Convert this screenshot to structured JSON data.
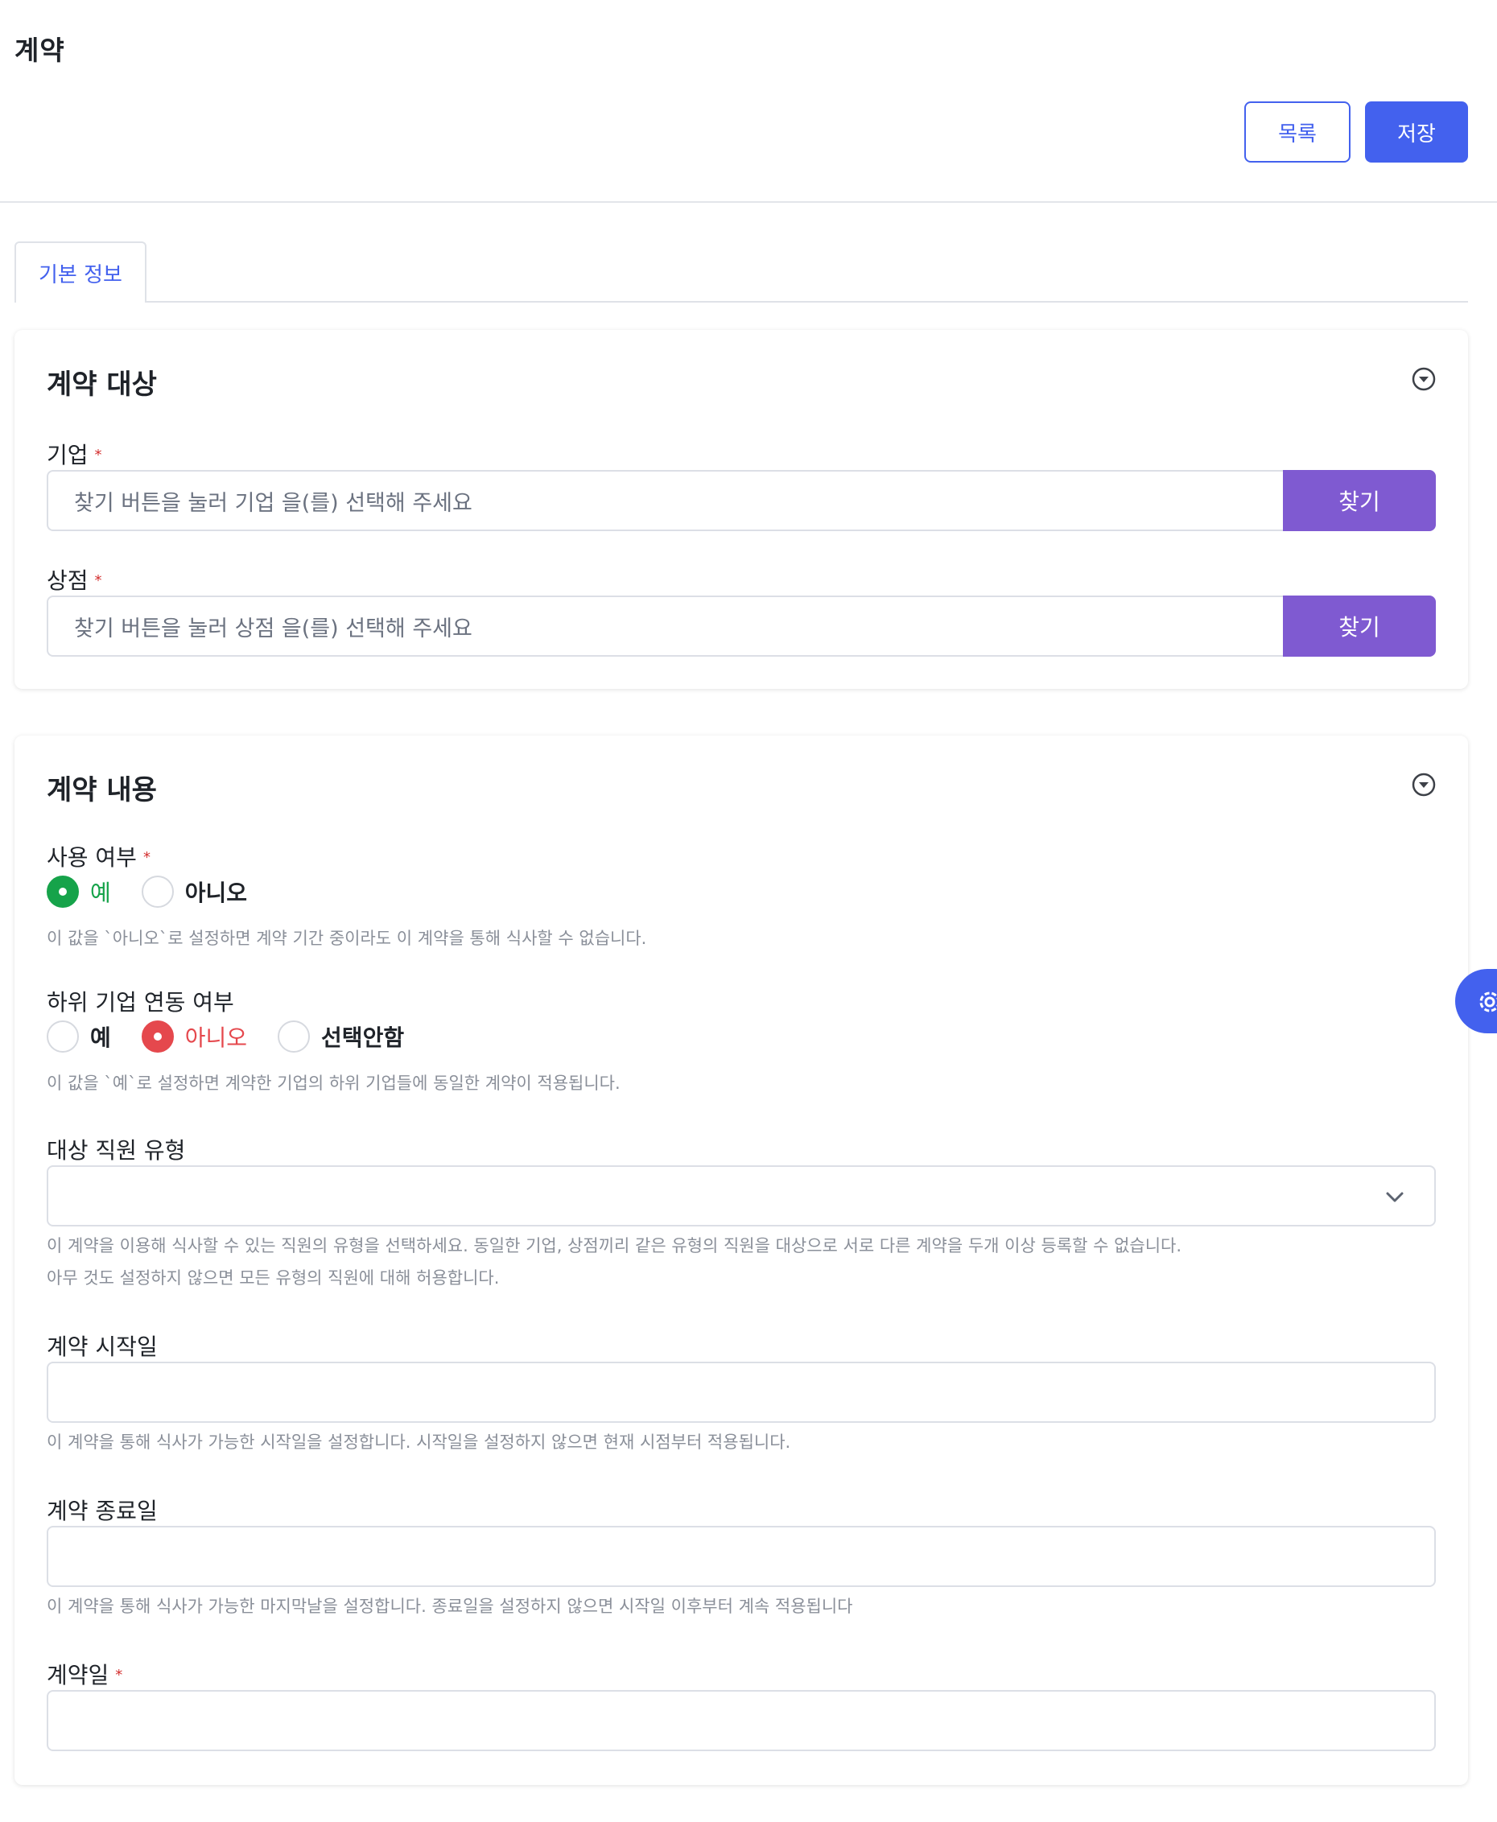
{
  "header": {
    "title": "계약",
    "list_button": "목록",
    "save_button": "저장"
  },
  "tabs": [
    {
      "label": "기본 정보",
      "active": true
    }
  ],
  "target_section": {
    "title": "계약 대상",
    "company": {
      "label": "기업",
      "required": true,
      "placeholder": "찾기 버튼을 눌러 기업 을(를) 선택해 주세요",
      "button": "찾기"
    },
    "store": {
      "label": "상점",
      "required": true,
      "placeholder": "찾기 버튼을 눌러 상점 을(를) 선택해 주세요",
      "button": "찾기"
    }
  },
  "content_section": {
    "title": "계약 내용",
    "usage": {
      "label": "사용 여부",
      "required": true,
      "options": [
        "예",
        "아니오"
      ],
      "selected": "예",
      "help": "이 값을 `아니오`로 설정하면 계약 기간 중이라도 이 계약을 통해 식사할 수 없습니다."
    },
    "sub_company_link": {
      "label": "하위 기업 연동 여부",
      "options": [
        "예",
        "아니오",
        "선택안함"
      ],
      "selected": "아니오",
      "help": "이 값을 `예`로 설정하면 계약한 기업의 하위 기업들에 동일한 계약이 적용됩니다."
    },
    "employee_type": {
      "label": "대상 직원 유형",
      "value": "",
      "help_1": "이 계약을 이용해 식사할 수 있는 직원의 유형을 선택하세요. 동일한 기업, 상점끼리 같은 유형의 직원을 대상으로 서로 다른 계약을 두개 이상 등록할 수 없습니다.",
      "help_2": "아무 것도 설정하지 않으면 모든 유형의 직원에 대해 허용합니다."
    },
    "start_date": {
      "label": "계약 시작일",
      "value": "",
      "help": "이 계약을 통해 식사가 가능한 시작일을 설정합니다. 시작일을 설정하지 않으면 현재 시점부터 적용됩니다."
    },
    "end_date": {
      "label": "계약 종료일",
      "value": "",
      "help": "이 계약을 통해 식사가 가능한 마지막날을 설정합니다. 종료일을 설정하지 않으면 시작일 이후부터 계속 적용됩니다"
    },
    "contract_date": {
      "label": "계약일",
      "required": true,
      "value": ""
    }
  },
  "required_mark": "*",
  "colors": {
    "primary": "#4361ee",
    "find_button": "#7f5ad1",
    "radio_selected_yes": "#16a34a",
    "radio_selected_no": "#e5484d",
    "required": "#d32f2f"
  },
  "icons": {
    "collapse": "chevron-circle-down-icon",
    "select": "chevron-down-icon",
    "floating": "gear-icon"
  }
}
